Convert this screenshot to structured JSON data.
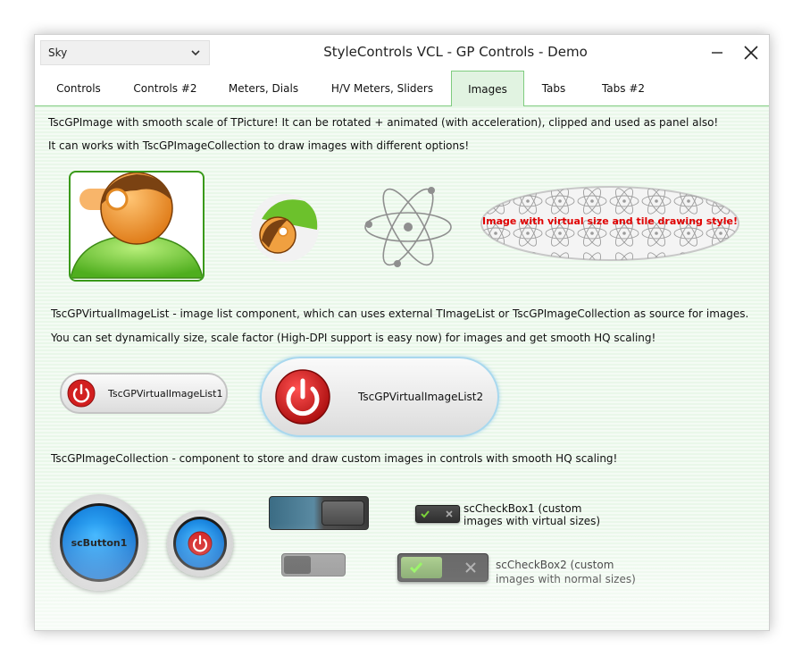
{
  "window": {
    "skin_value": "Sky",
    "title": "StyleControls VCL - GP Controls - Demo"
  },
  "tabs": [
    {
      "label": "Controls"
    },
    {
      "label": "Controls #2"
    },
    {
      "label": "Meters, Dials"
    },
    {
      "label": "H/V Meters, Sliders"
    },
    {
      "label": "Images",
      "active": true
    },
    {
      "label": "Tabs"
    },
    {
      "label": "Tabs #2"
    }
  ],
  "images_section": {
    "line1": "TscGPImage with smooth scale of TPicture! It can be rotated + animated (with acceleration), clipped and used as panel also!",
    "line2": "It can works with TscGPImageCollection to draw images with different options!",
    "tile_caption": "Image with virtual size and tile drawing style!"
  },
  "virtual_list_section": {
    "line1": "TscGPVirtualImageList - image list component, which can uses external TImageList or TscGPImageCollection as source for images.",
    "line2": "You can set dynamically size, scale factor (High-DPI support is easy now) for images and get smooth HQ scaling!",
    "button1_label": "TscGPVirtualImageList1",
    "button2_label": "TscGPVirtualImageList2"
  },
  "collection_section": {
    "line1": "TscGPImageCollection - component to store and draw custom images in controls with smooth HQ scaling!",
    "round_button_label": "scButton1",
    "checkbox1_label_l1": "scCheckBox1 (custom",
    "checkbox1_label_l2": "images with virtual sizes)",
    "checkbox2_label_l1": "scCheckBox2 (custom",
    "checkbox2_label_l2": "images with normal sizes)"
  },
  "colors": {
    "accent_green": "#7fcc7f",
    "tab_active_bg": "#e1f3e1",
    "power_red": "#d21f1f",
    "round_button_blue": "#0a7fe0",
    "tile_text_red": "#e00000"
  },
  "icons": [
    "chevron-down-icon",
    "minimize-icon",
    "close-icon",
    "user-avatar-icon",
    "atom-icon",
    "power-icon",
    "check-icon",
    "x-mark-icon"
  ]
}
